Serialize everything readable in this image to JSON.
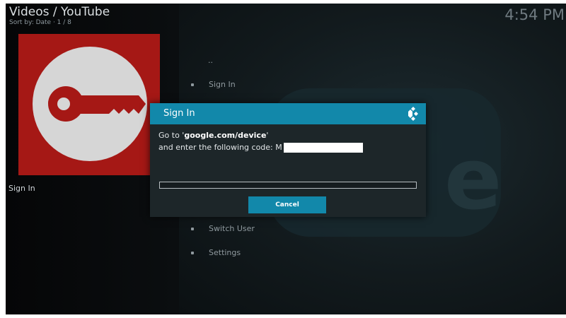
{
  "header": {
    "breadcrumb": "Videos / YouTube",
    "sort_info": "Sort by: Date  ·  1 / 8",
    "clock": "4:54 PM"
  },
  "sidebar": {
    "selected_label": "Sign In"
  },
  "list": {
    "up_item": "..",
    "items": [
      {
        "label": "Sign In"
      },
      {
        "label": "Switch User"
      },
      {
        "label": "Settings"
      }
    ]
  },
  "dialog": {
    "title": "Sign In",
    "line1_prefix": "Go to '",
    "line1_url": "google.com/device",
    "line1_suffix": "'",
    "line2_text": "and enter the following code: M",
    "progress": 0,
    "cancel_label": "Cancel"
  },
  "colors": {
    "accent": "#1288aa",
    "thumb_background": "#a51815"
  },
  "icons": {
    "thumbnail": "key-icon",
    "dialog_logo": "kodi-logo-icon"
  }
}
